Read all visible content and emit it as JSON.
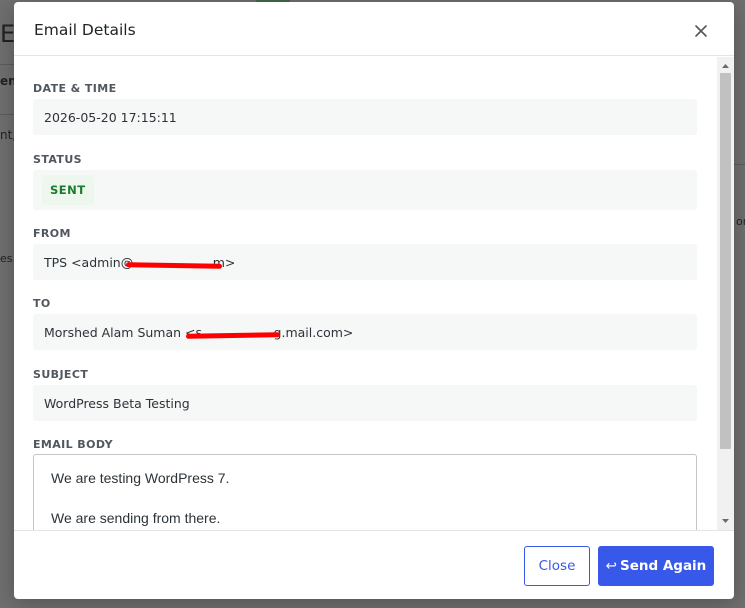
{
  "background": {
    "fragments": [
      "Er",
      "ent",
      "nt,",
      "es.",
      "on"
    ]
  },
  "modal": {
    "title": "Email Details",
    "fields": {
      "datetime": {
        "label": "DATE & TIME",
        "value": "2026-05-20 17:15:11"
      },
      "status": {
        "label": "STATUS",
        "value": "SENT"
      },
      "from": {
        "label": "FROM",
        "value": "TPS <admin@                    m>"
      },
      "to": {
        "label": "TO",
        "value": "Morshed Alam Suman <s                  g.mail.com>"
      },
      "subject": {
        "label": "SUBJECT",
        "value": "WordPress Beta Testing"
      },
      "body": {
        "label": "EMAIL BODY",
        "paragraphs": [
          "We are testing WordPress 7.",
          "We are sending from there."
        ]
      }
    },
    "footer": {
      "close_label": "Close",
      "send_label": "Send Again",
      "send_icon": "↩"
    }
  },
  "colors": {
    "accent": "#3858e9",
    "status_sent": "#1a7a2e",
    "redaction": "#ff0000"
  }
}
